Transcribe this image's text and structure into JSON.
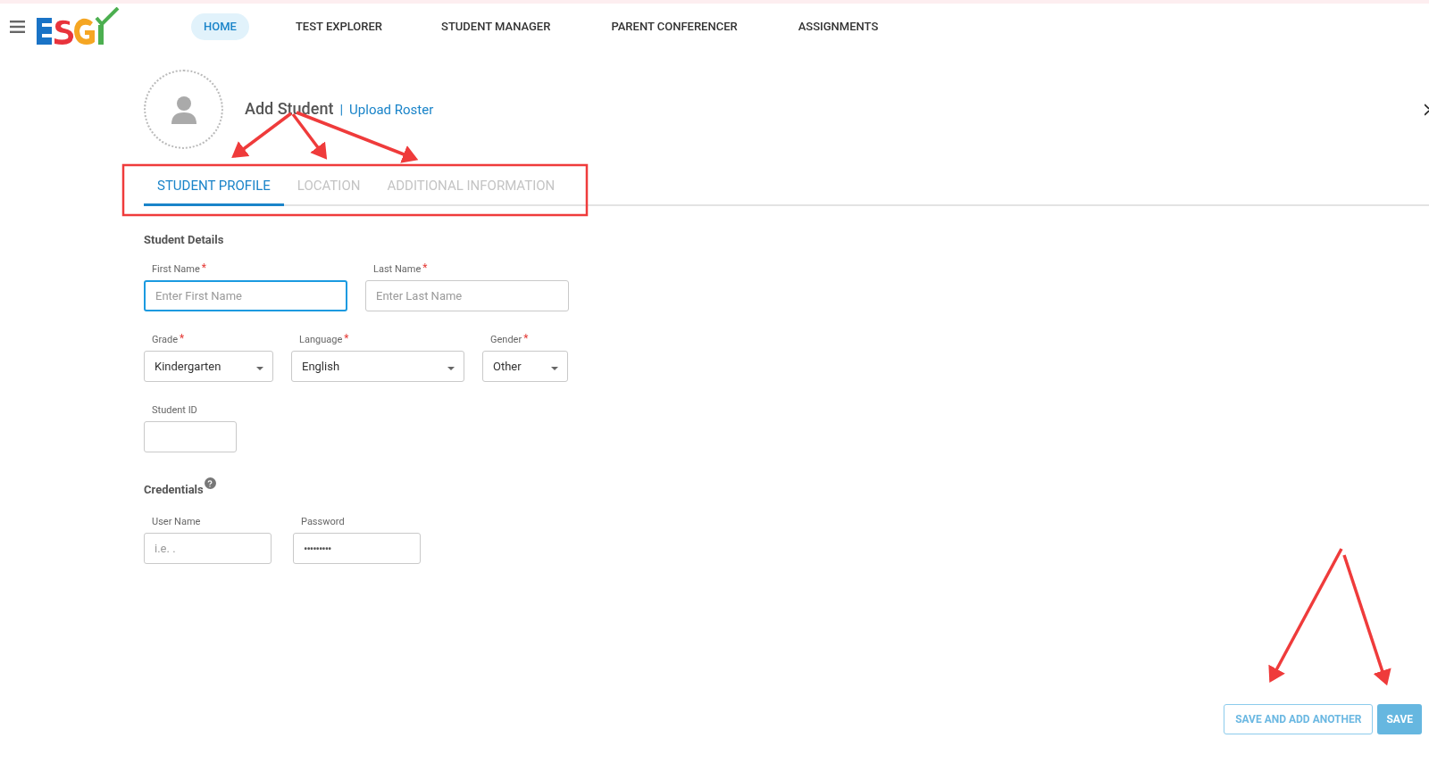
{
  "nav": {
    "items": [
      {
        "label": "HOME",
        "selected": true
      },
      {
        "label": "TEST EXPLORER",
        "selected": false
      },
      {
        "label": "STUDENT MANAGER",
        "selected": false
      },
      {
        "label": "PARENT CONFERENCER",
        "selected": false
      },
      {
        "label": "ASSIGNMENTS",
        "selected": false
      }
    ]
  },
  "header": {
    "title": "Add Student",
    "separator": "|",
    "link": "Upload Roster"
  },
  "tabs": [
    {
      "label": "STUDENT PROFILE",
      "selected": true
    },
    {
      "label": "LOCATION",
      "selected": false
    },
    {
      "label": "ADDITIONAL INFORMATION",
      "selected": false
    }
  ],
  "student_details": {
    "title": "Student Details",
    "rows": [
      [
        {
          "kind": "text",
          "label": "First Name",
          "required_mark": "*",
          "placeholder": "Enter First Name",
          "focused": true
        },
        {
          "kind": "text",
          "label": "Last Name",
          "required_mark": "*",
          "placeholder": "Enter Last Name",
          "focused": false
        }
      ],
      [
        {
          "kind": "select",
          "label": "Grade",
          "required_mark": "*",
          "value": "Kindergarten",
          "focused": false
        },
        {
          "kind": "select",
          "label": "Language",
          "required_mark": "*",
          "value": "English",
          "focused": false
        },
        {
          "kind": "select",
          "label": "Gender",
          "required_mark": "*",
          "value": "Other",
          "focused": false
        }
      ],
      [
        {
          "kind": "text",
          "label": "Student ID",
          "focused": false
        }
      ]
    ]
  },
  "credentials": {
    "title": "Credentials",
    "help": true,
    "fields": [
      {
        "kind": "text",
        "label": "User Name",
        "placeholder": "i.e. .",
        "focused": false
      },
      {
        "kind": "password",
        "label": "Password",
        "placeholder": "•••••••••",
        "focused": false
      }
    ]
  },
  "buttons": [
    {
      "kind": "outline",
      "label": "SAVE AND ADD ANOTHER"
    },
    {
      "kind": "primary",
      "label": "SAVE"
    }
  ]
}
